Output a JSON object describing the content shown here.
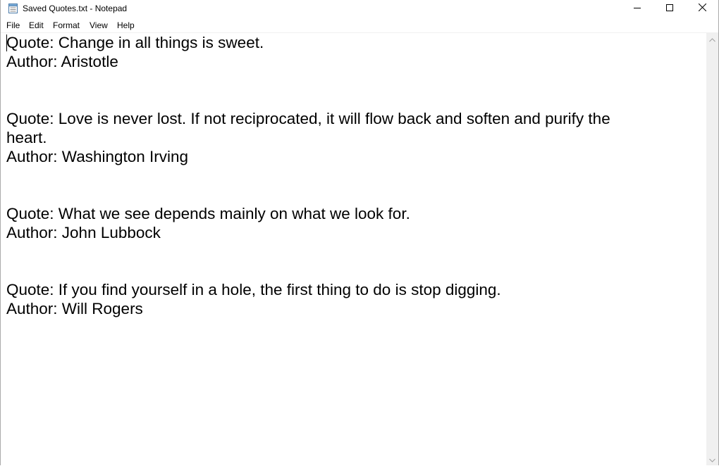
{
  "window": {
    "title": "Saved Quotes.txt - Notepad",
    "app_icon": "notepad-icon"
  },
  "controls": {
    "minimize_icon": "minimize-icon",
    "maximize_icon": "maximize-icon",
    "close_icon": "close-icon"
  },
  "menu": {
    "items": [
      {
        "label": "File"
      },
      {
        "label": "Edit"
      },
      {
        "label": "Format"
      },
      {
        "label": "View"
      },
      {
        "label": "Help"
      }
    ]
  },
  "editor": {
    "lines": [
      "Quote: Change in all things is sweet.",
      "Author: Aristotle",
      "",
      "",
      "Quote: Love is never lost. If not reciprocated, it will flow back and soften and purify the",
      "heart.",
      "Author: Washington Irving",
      "",
      "",
      "Quote: What we see depends mainly on what we look for.",
      "Author: John Lubbock",
      "",
      "",
      "Quote: If you find yourself in a hole, the first thing to do is stop digging.",
      "Author: Will Rogers"
    ]
  },
  "colors": {
    "text": "#000000",
    "background": "#ffffff",
    "scrollbar": "#f0f0f0"
  }
}
